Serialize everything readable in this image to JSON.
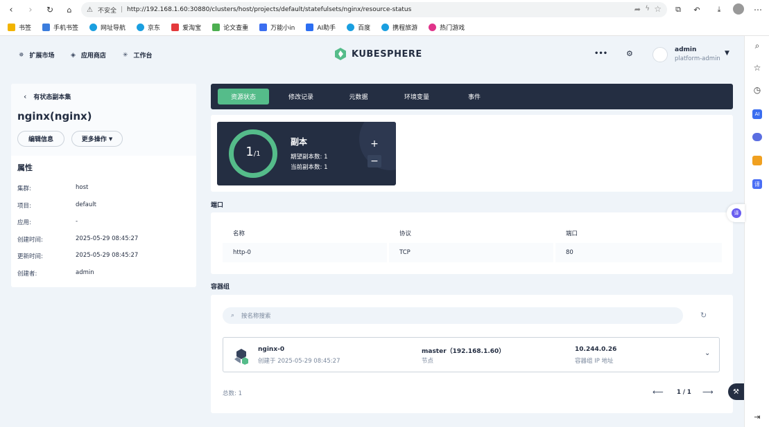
{
  "browser": {
    "insecure_label": "不安全",
    "url": "http://192.168.1.60:30880/clusters/host/projects/default/statefulsets/nginx/resource-status",
    "bookmarks": [
      {
        "label": "书签",
        "color": "#f2b400"
      },
      {
        "label": "手机书签",
        "color": "#3b7ddd"
      },
      {
        "label": "网址导航",
        "color": "#1a9fe0"
      },
      {
        "label": "京东",
        "color": "#1a9fe0"
      },
      {
        "label": "爱淘宝",
        "color": "#e4393c"
      },
      {
        "label": "论文查重",
        "color": "#4caf50"
      },
      {
        "label": "万能小in",
        "color": "#3b6ef0"
      },
      {
        "label": "AI助手",
        "color": "#2c6ef2"
      },
      {
        "label": "百度",
        "color": "#1a9fe0"
      },
      {
        "label": "携程旅游",
        "color": "#1a9fe0"
      },
      {
        "label": "热门游戏",
        "color": "#e0338a"
      }
    ]
  },
  "header": {
    "nav": [
      {
        "label": "扩展市场",
        "icon": "extension-market-icon"
      },
      {
        "label": "应用商店",
        "icon": "app-store-icon"
      },
      {
        "label": "工作台",
        "icon": "workbench-icon"
      }
    ],
    "logo_text": "KUBESPHERE",
    "user_name": "admin",
    "user_role": "platform-admin"
  },
  "left": {
    "back_label": "有状态副本集",
    "title": "nginx(nginx)",
    "edit_label": "编辑信息",
    "more_label": "更多操作",
    "attr_title": "属性",
    "attrs": [
      {
        "k": "集群:",
        "v": "host"
      },
      {
        "k": "项目:",
        "v": "default"
      },
      {
        "k": "应用:",
        "v": "-"
      },
      {
        "k": "创建时间:",
        "v": "2025-05-29 08:45:27"
      },
      {
        "k": "更新时间:",
        "v": "2025-05-29 08:45:27"
      },
      {
        "k": "创建者:",
        "v": "admin"
      }
    ]
  },
  "tabs": [
    "资源状态",
    "修改记录",
    "元数据",
    "环境变量",
    "事件"
  ],
  "replica": {
    "current": "1",
    "total": "/1",
    "title": "副本",
    "desired": "期望副本数: 1",
    "actual": "当前副本数: 1"
  },
  "ports": {
    "section_title": "端口",
    "columns": [
      "名称",
      "协议",
      "端口"
    ],
    "rows": [
      [
        "http-0",
        "TCP",
        "80"
      ]
    ]
  },
  "pods": {
    "section_title": "容器组",
    "search_placeholder": "按名称搜索",
    "items": [
      {
        "name": "nginx-0",
        "created": "创建于 2025-05-29 08:45:27",
        "node": "master（192.168.1.60）",
        "node_label": "节点",
        "ip": "10.244.0.26",
        "ip_label": "容器组 IP 地址"
      }
    ],
    "total": "总数: 1",
    "page": "1 / 1"
  }
}
